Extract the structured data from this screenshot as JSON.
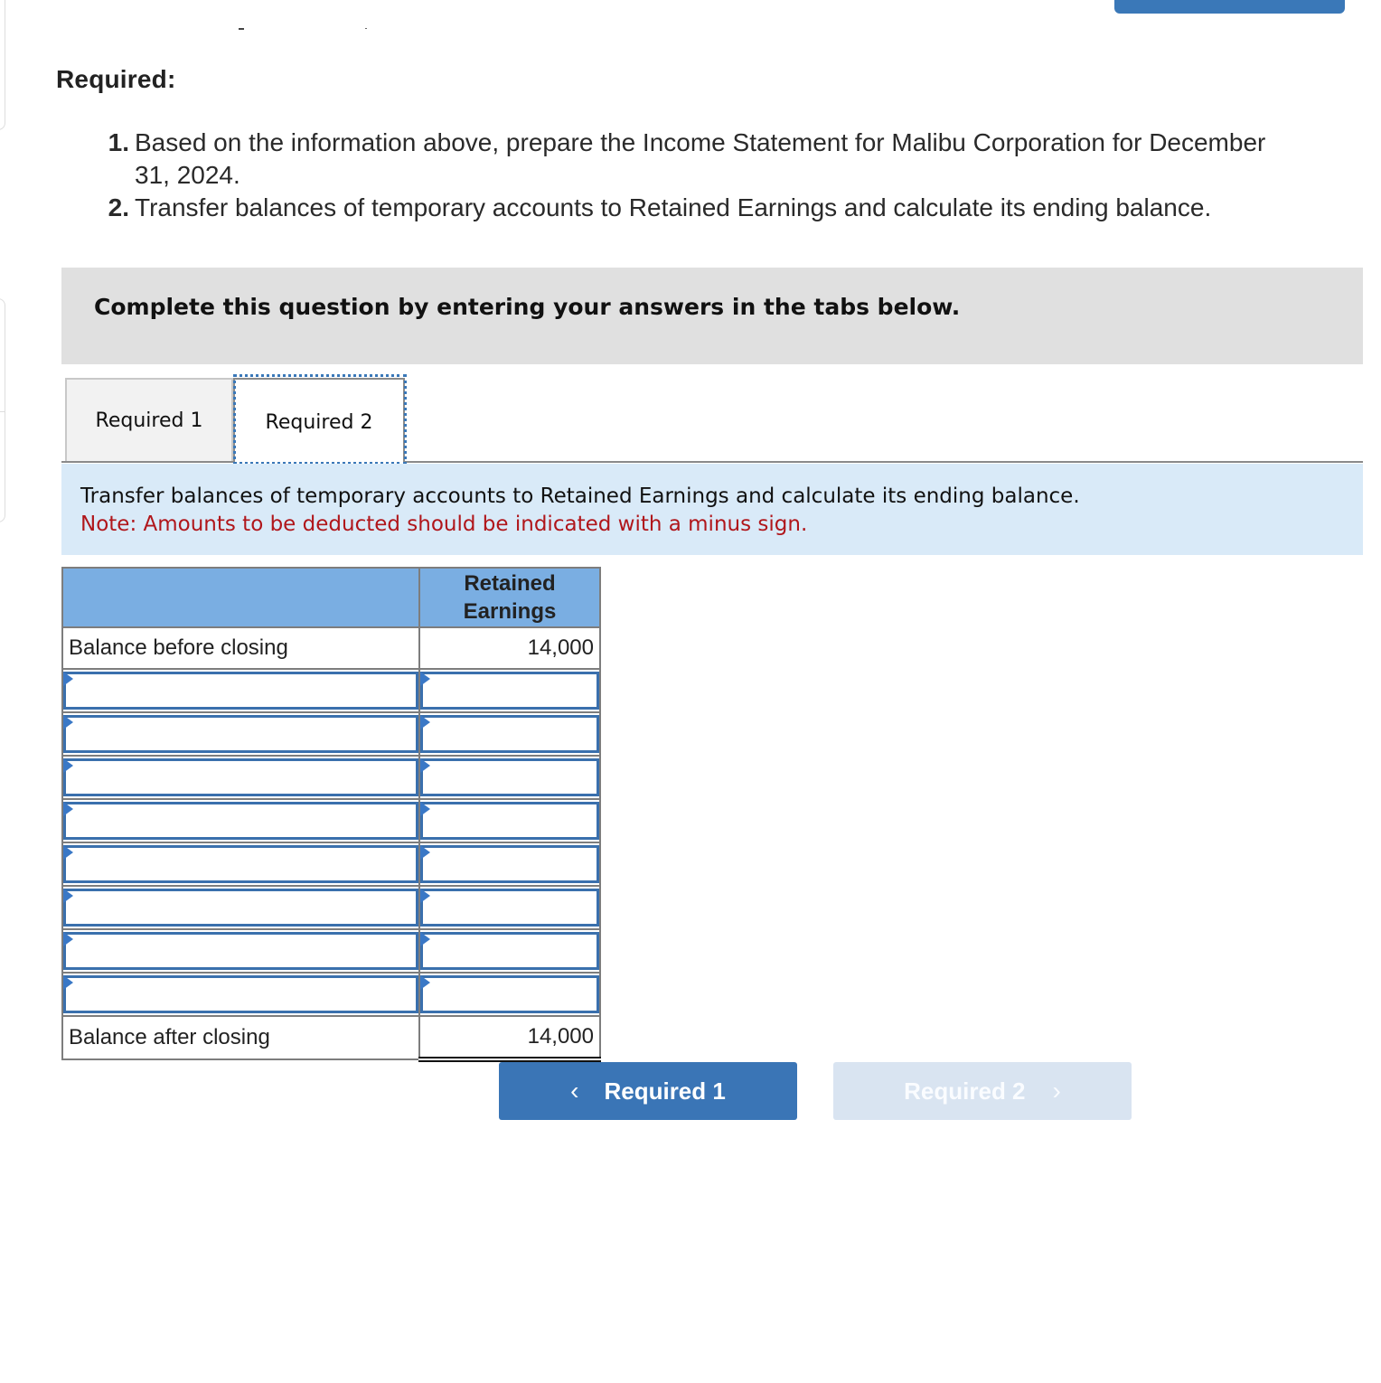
{
  "page": {
    "required_heading": "Required:",
    "requirements": [
      {
        "num": "1.",
        "text": "Based on the information above, prepare the Income Statement for Malibu Corporation for December 31, 2024."
      },
      {
        "num": "2.",
        "text": "Transfer balances of temporary accounts to Retained Earnings and calculate its ending balance."
      }
    ],
    "instruction": "Complete this question by entering your answers in the tabs below."
  },
  "tabs": [
    {
      "label": "Required 1",
      "active": false
    },
    {
      "label": "Required 2",
      "active": true
    }
  ],
  "task": {
    "description": "Transfer balances of temporary accounts to Retained Earnings and calculate its ending balance.",
    "note": "Note: Amounts to be deducted should be indicated with a minus sign."
  },
  "ledger": {
    "header_label": "",
    "header_value": "Retained Earnings",
    "opening": {
      "label": "Balance before closing",
      "value": "14,000"
    },
    "input_rows": [
      {
        "label": "",
        "value": ""
      },
      {
        "label": "",
        "value": ""
      },
      {
        "label": "",
        "value": ""
      },
      {
        "label": "",
        "value": ""
      },
      {
        "label": "",
        "value": ""
      },
      {
        "label": "",
        "value": ""
      },
      {
        "label": "",
        "value": ""
      },
      {
        "label": "",
        "value": ""
      }
    ],
    "closing": {
      "label": "Balance after closing",
      "value": "14,000"
    }
  },
  "navigation": {
    "prev": {
      "label": "Required 1",
      "icon": "chevron-left-icon",
      "glyph": "‹"
    },
    "next": {
      "label": "Required 2",
      "icon": "chevron-right-icon",
      "glyph": "›",
      "disabled": true
    }
  },
  "colors": {
    "accent": "#3a75b6",
    "header_fill": "#7aaee2",
    "task_fill": "#d9eaf8",
    "note_red": "#b0161b",
    "disabled_button": "#d9e4f1"
  }
}
